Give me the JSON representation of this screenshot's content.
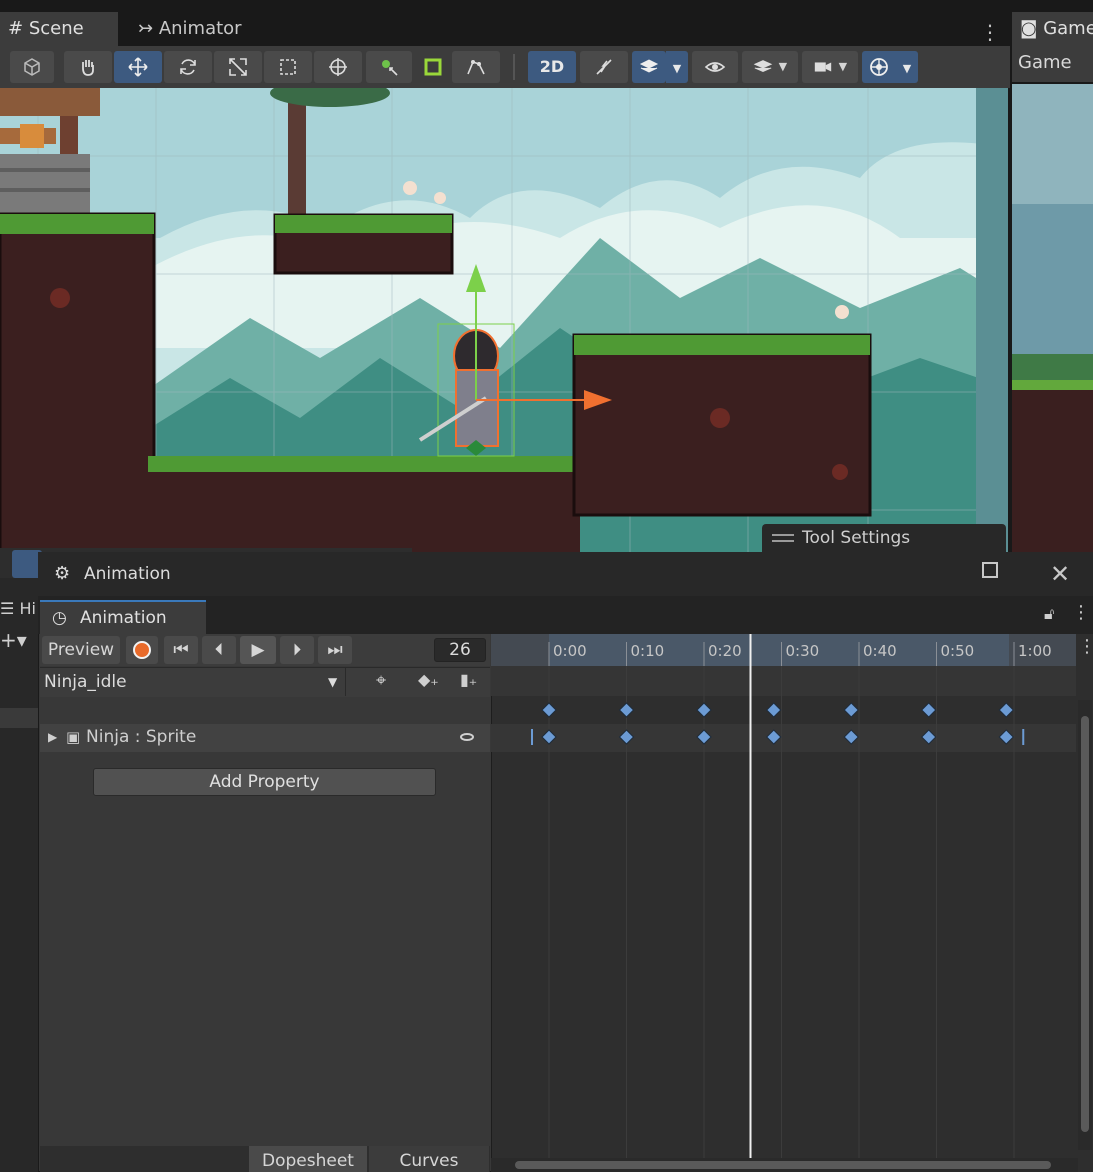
{
  "tabs": {
    "scene": "Scene",
    "animator": "Animator",
    "game": "Game",
    "game_toolbar": "Game"
  },
  "scene_toolbar": {
    "mode_2d": "2D"
  },
  "tool_settings": "Tool Settings",
  "hierarchy_tab": "Hi",
  "animation_window": {
    "title": "Animation",
    "tab": "Animation",
    "preview_label": "Preview",
    "frame": "26",
    "clip": "Ninja_idle",
    "property": "Ninja : Sprite",
    "add_property": "Add Property",
    "dopesheet_tab": "Dopesheet",
    "curves_tab": "Curves",
    "ruler_labels": [
      "0:00",
      "0:10",
      "0:20",
      "0:30",
      "0:40",
      "0:50",
      "1:00"
    ],
    "playhead_time": "0:26",
    "keyframes": [
      "0:00",
      "0:10",
      "0:20",
      "0:29",
      "0:39",
      "0:49",
      "0:59"
    ]
  },
  "colors": {
    "accent_blue": "#3d5a80",
    "keyframe": "#6c9bd4",
    "record": "#e86a2a",
    "gizmo_green": "#7cd04a",
    "gizmo_orange": "#f07030"
  }
}
